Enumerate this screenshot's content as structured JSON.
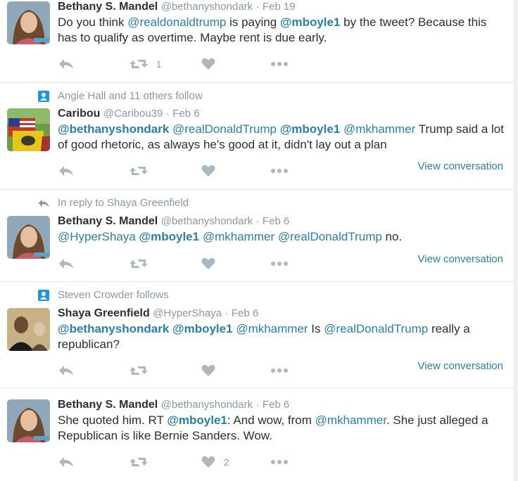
{
  "colors": {
    "link": "#2a7fa8",
    "muted": "#8899a6",
    "text": "#292f33",
    "icon": "#aab8c2",
    "follow_icon": "#1b95e0"
  },
  "tweets": [
    {
      "name": "Bethany S. Mandel",
      "handle": "@bethanyshondark",
      "sep": "·",
      "date": "Feb 19",
      "text_parts": [
        "Do you think ",
        "@realdonaldtrump",
        " is paying ",
        "@mboyle1",
        " by the tweet? Because this has to qualify as overtime. Maybe rent is due early."
      ],
      "retweet_count": "1",
      "like_count": ""
    },
    {
      "context": "Angie Hall and 11 others follow",
      "name": "Caribou",
      "handle": "@Caribou39",
      "sep": "·",
      "date": "Feb 6",
      "text_parts": [
        "@bethanyshondark",
        " ",
        "@realDonaldTrump",
        " ",
        "@mboyle1",
        " ",
        "@mkhammer",
        " Trump said a lot of good rhetoric,  as always he's good at it, didn't lay out a plan"
      ],
      "view_conversation": "View conversation"
    },
    {
      "context": "In reply to Shaya Greenfield",
      "name": "Bethany S. Mandel",
      "handle": "@bethanyshondark",
      "sep": "·",
      "date": "Feb 6",
      "text_parts": [
        "@HyperShaya",
        " ",
        "@mboyle1",
        " ",
        "@mkhammer",
        " ",
        "@realDonaldTrump",
        " no."
      ],
      "view_conversation": "View conversation"
    },
    {
      "context": "Steven Crowder follows",
      "name": "Shaya Greenfield",
      "handle": "@HyperShaya",
      "sep": "·",
      "date": "Feb 6",
      "text_parts": [
        "@bethanyshondark",
        " ",
        "@mboyle1",
        " ",
        "@mkhammer",
        " Is ",
        "@realDonaldTrump",
        " really a republican?"
      ],
      "view_conversation": "View conversation"
    },
    {
      "name": "Bethany S. Mandel",
      "handle": "@bethanyshondark",
      "sep": "·",
      "date": "Feb 6",
      "text_parts": [
        "She quoted him. RT ",
        "@mboyle1",
        ": And wow, from ",
        "@mkhammer",
        ". She just alleged a Republican is like Bernie Sanders. Wow."
      ],
      "retweet_count": "",
      "like_count": "2"
    }
  ]
}
